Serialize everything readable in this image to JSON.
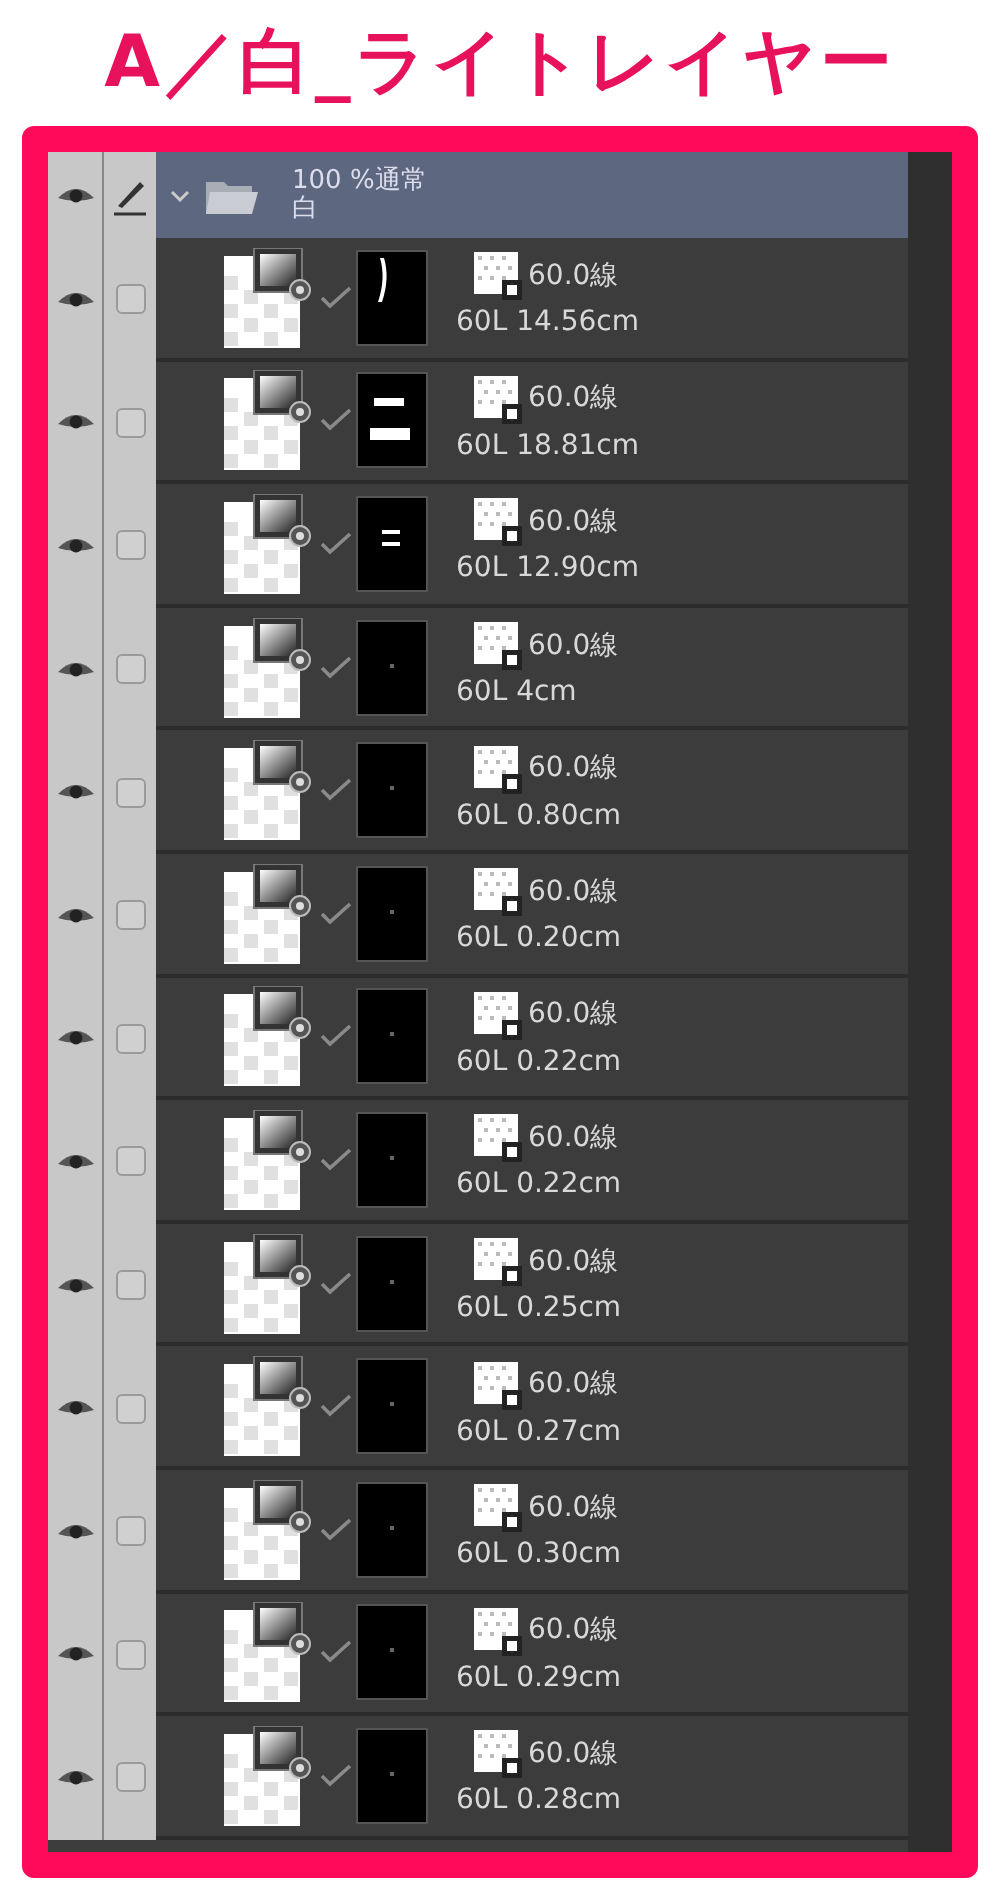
{
  "title": "A／白_ライトレイヤー",
  "folder": {
    "visible": true,
    "editing": true,
    "expanded": true,
    "blend": "100 %通常",
    "name": "白"
  },
  "layers": [
    {
      "visible": true,
      "editing": false,
      "clipped": true,
      "kind": "stroke",
      "info": "60.0線",
      "name": "60L 14.56cm"
    },
    {
      "visible": true,
      "editing": false,
      "clipped": true,
      "kind": "bars",
      "info": "60.0線",
      "name": "60L 18.81cm"
    },
    {
      "visible": true,
      "editing": false,
      "clipped": true,
      "kind": "dashes",
      "info": "60.0線",
      "name": "60L 12.90cm"
    },
    {
      "visible": true,
      "editing": false,
      "clipped": true,
      "kind": "speck",
      "info": "60.0線",
      "name": "60L 4cm"
    },
    {
      "visible": true,
      "editing": false,
      "clipped": true,
      "kind": "speck",
      "info": "60.0線",
      "name": "60L 0.80cm"
    },
    {
      "visible": true,
      "editing": false,
      "clipped": true,
      "kind": "speck",
      "info": "60.0線",
      "name": "60L 0.20cm"
    },
    {
      "visible": true,
      "editing": false,
      "clipped": true,
      "kind": "speck",
      "info": "60.0線",
      "name": "60L 0.22cm"
    },
    {
      "visible": true,
      "editing": false,
      "clipped": true,
      "kind": "speck",
      "info": "60.0線",
      "name": "60L 0.22cm"
    },
    {
      "visible": true,
      "editing": false,
      "clipped": true,
      "kind": "speck",
      "info": "60.0線",
      "name": "60L 0.25cm"
    },
    {
      "visible": true,
      "editing": false,
      "clipped": true,
      "kind": "speck",
      "info": "60.0線",
      "name": "60L 0.27cm"
    },
    {
      "visible": true,
      "editing": false,
      "clipped": true,
      "kind": "speck",
      "info": "60.0線",
      "name": "60L 0.30cm"
    },
    {
      "visible": true,
      "editing": false,
      "clipped": true,
      "kind": "speck",
      "info": "60.0線",
      "name": "60L 0.29cm"
    },
    {
      "visible": true,
      "editing": false,
      "clipped": true,
      "kind": "speck",
      "info": "60.0線",
      "name": "60L 0.28cm"
    }
  ]
}
